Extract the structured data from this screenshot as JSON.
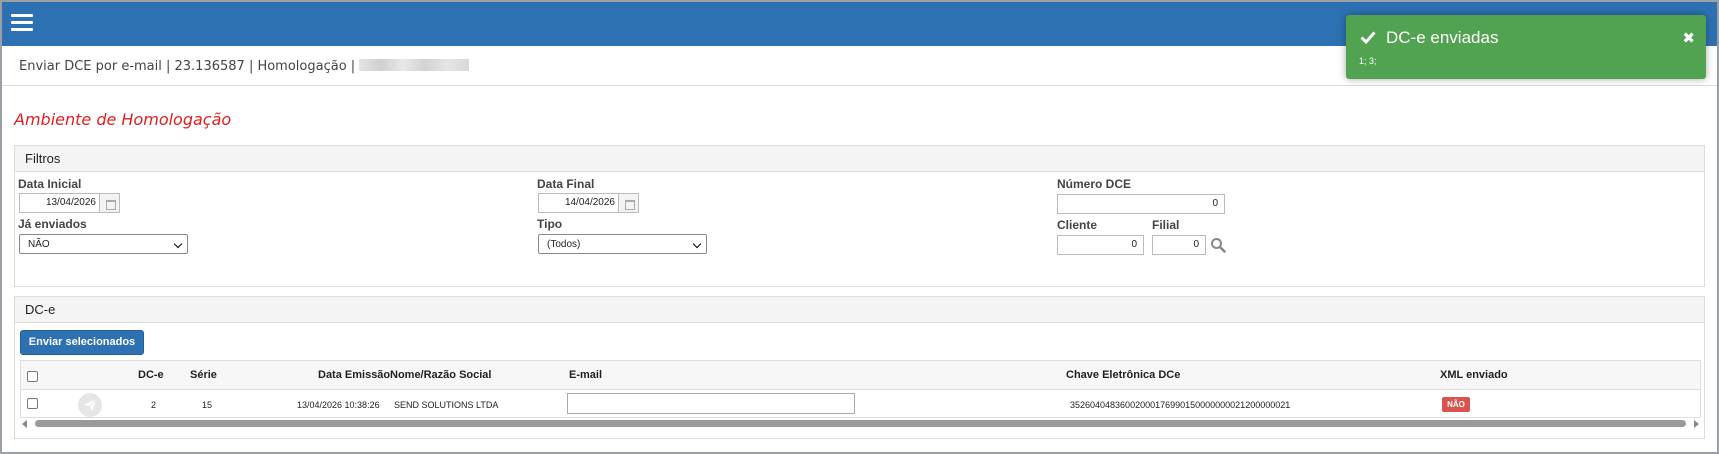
{
  "app": {
    "title_text": "Enviar DCE por e-mail | 23.136587 | Homologação | ",
    "environment_label": "Ambiente de Homologação"
  },
  "filters": {
    "panel_title": "Filtros",
    "data_inicial_label": "Data Inicial",
    "data_inicial_value": "13/04/2026",
    "data_final_label": "Data Final",
    "data_final_value": "14/04/2026",
    "numero_dce_label": "Número DCE",
    "numero_dce_value": "0",
    "ja_enviados_label": "Já enviados",
    "ja_enviados_value": "NÃO",
    "tipo_label": "Tipo",
    "tipo_value": "(Todos)",
    "cliente_label": "Cliente",
    "cliente_value": "0",
    "filial_label": "Filial",
    "filial_value": "0"
  },
  "dce": {
    "panel_title": "DC-e",
    "send_selected_label": "Enviar selecionados",
    "columns": {
      "dce": "DC-e",
      "serie": "Série",
      "data_emissao": "Data Emissão",
      "nome": "Nome/Razão Social",
      "email": "E-mail",
      "chave": "Chave Eletrônica DCe",
      "xml": "XML enviado"
    },
    "rows": [
      {
        "dce": "2",
        "serie": "15",
        "data_emissao": "13/04/2026 10:38:26",
        "nome": "SEND SOLUTIONS LTDA",
        "email": "",
        "chave": "35260404836002000176990150000000021200000021",
        "xml_enviado": "NÃO"
      }
    ]
  },
  "toast": {
    "title": "DC-e enviadas",
    "message": "1; 3;",
    "color": "#51a351"
  },
  "colors": {
    "topbar": "#2e71b3",
    "primary_button": "#2e71b3",
    "environment_text": "#e02020",
    "badge_no": "#d9534f"
  }
}
